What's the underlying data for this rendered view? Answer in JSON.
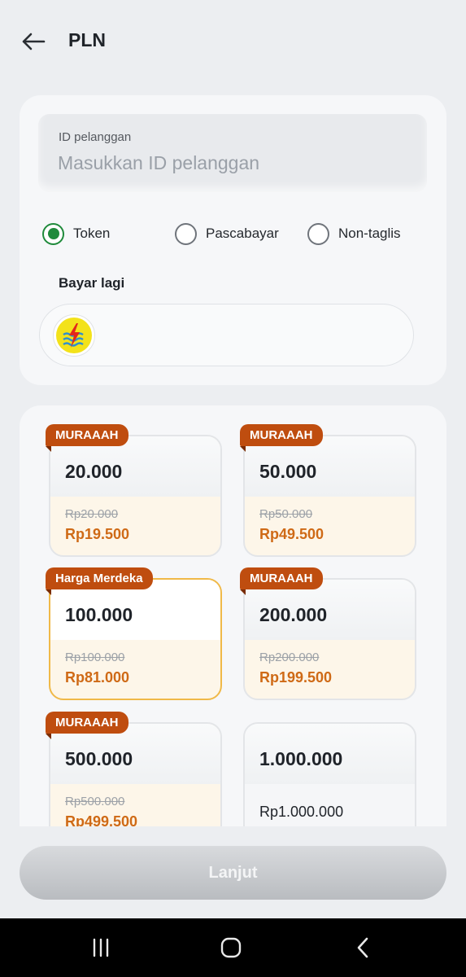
{
  "header": {
    "title": "PLN",
    "back_icon": "arrow-left-icon"
  },
  "form": {
    "id_label": "ID pelanggan",
    "id_placeholder": "Masukkan ID pelanggan",
    "id_value": ""
  },
  "payment_types": [
    {
      "label": "Token",
      "checked": true
    },
    {
      "label": "Pascabayar",
      "checked": false
    },
    {
      "label": "Non-taglis",
      "checked": false
    }
  ],
  "recent": {
    "title": "Bayar lagi",
    "items": [
      {
        "icon": "pln-logo-icon"
      }
    ]
  },
  "products": [
    {
      "badge": "MURAAAH",
      "nominal": "20.000",
      "old_price": "Rp20.000",
      "price": "Rp19.500",
      "selected": false
    },
    {
      "badge": "MURAAAH",
      "nominal": "50.000",
      "old_price": "Rp50.000",
      "price": "Rp49.500",
      "selected": false
    },
    {
      "badge": "Harga Merdeka",
      "nominal": "100.000",
      "old_price": "Rp100.000",
      "price": "Rp81.000",
      "selected": true
    },
    {
      "badge": "MURAAAH",
      "nominal": "200.000",
      "old_price": "Rp200.000",
      "price": "Rp199.500",
      "selected": false
    },
    {
      "badge": "MURAAAH",
      "nominal": "500.000",
      "old_price": "Rp500.000",
      "price": "Rp499.500",
      "selected": false
    },
    {
      "badge": "",
      "nominal": "1.000.000",
      "old_price": "",
      "price": "Rp1.000.000",
      "selected": false
    }
  ],
  "footer": {
    "button_label": "Lanjut"
  },
  "colors": {
    "accent_green": "#1f8a3b",
    "badge_orange": "#bf4d0f",
    "price_orange": "#cf6a16",
    "selected_border": "#f0b948"
  },
  "navbar": {
    "icons": [
      "recent-apps-icon",
      "home-icon",
      "back-icon"
    ]
  }
}
